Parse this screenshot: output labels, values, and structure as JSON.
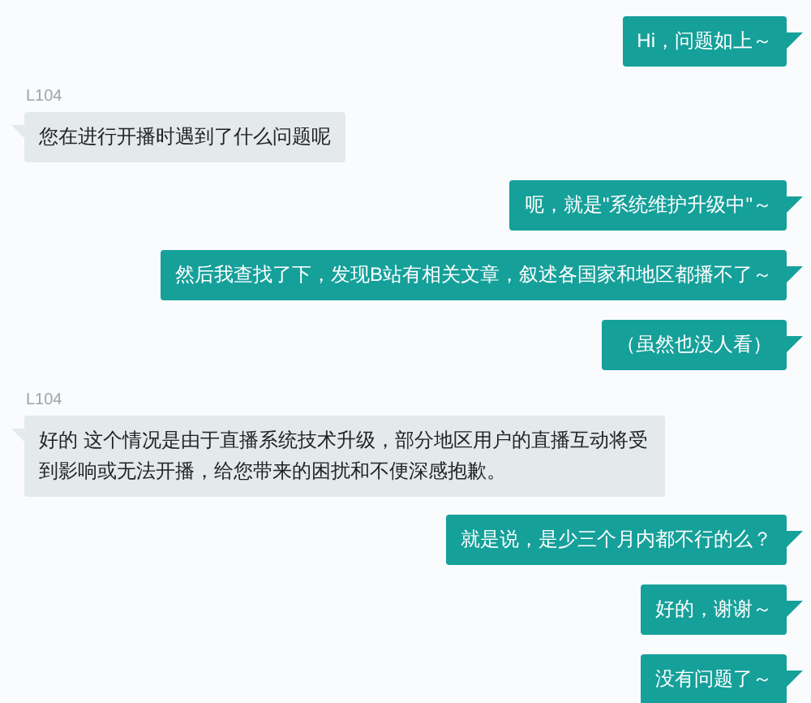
{
  "messages": [
    {
      "kind": "sent",
      "text": "Hi，问题如上～"
    },
    {
      "kind": "received",
      "sender": "L104",
      "text": "您在进行开播时遇到了什么问题呢"
    },
    {
      "kind": "sent",
      "text": "呃，就是\"系统维护升级中\"～"
    },
    {
      "kind": "sent",
      "text": "然后我查找了下，发现B站有相关文章，叙述各国家和地区都播不了～"
    },
    {
      "kind": "sent",
      "text": "（虽然也没人看）"
    },
    {
      "kind": "received",
      "sender": "L104",
      "text": "好的 这个情况是由于直播系统技术升级，部分地区用户的直播互动将受到影响或无法开播，给您带来的困扰和不便深感抱歉。"
    },
    {
      "kind": "sent",
      "text": "就是说，是少三个月内都不行的么？"
    },
    {
      "kind": "sent",
      "text": "好的，谢谢～"
    },
    {
      "kind": "sent",
      "text": "没有问题了～"
    }
  ]
}
